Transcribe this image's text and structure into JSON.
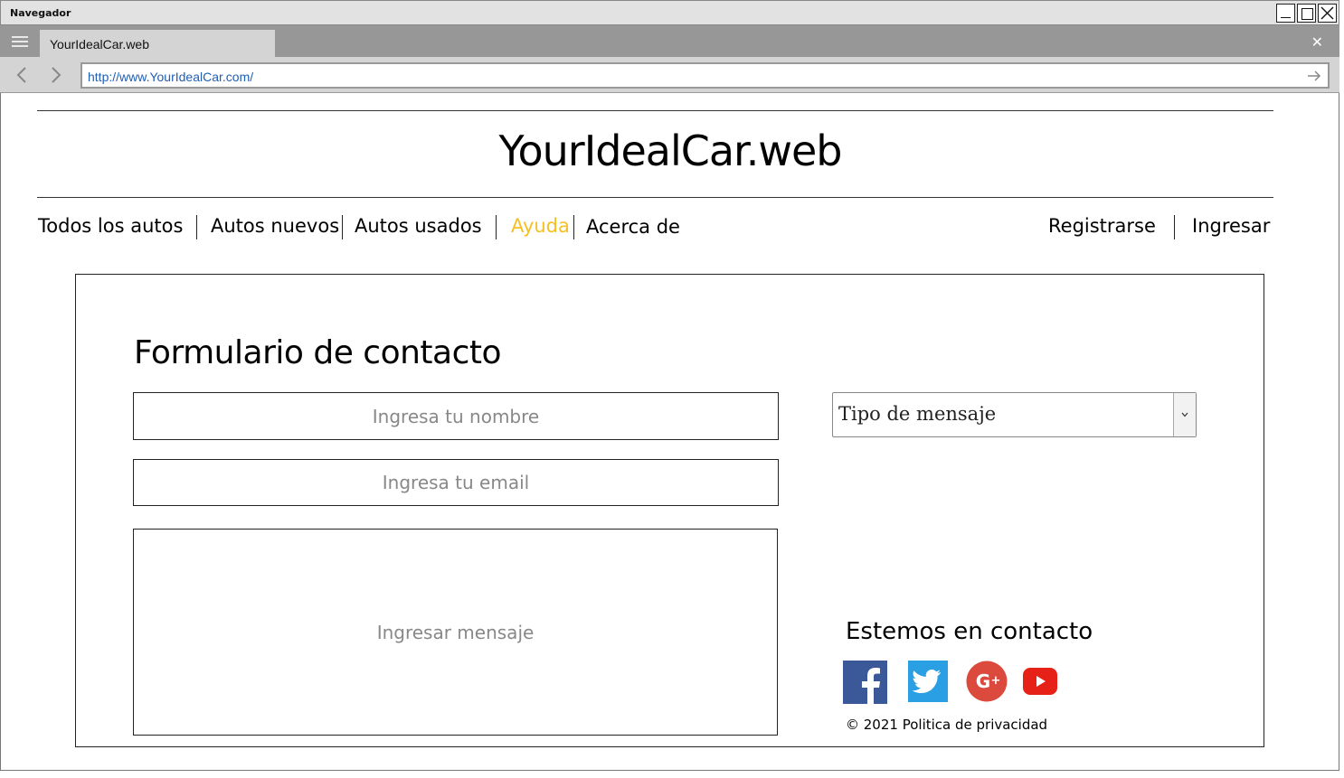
{
  "window": {
    "title": "Navegador"
  },
  "browser": {
    "tab_label": "YourIdealCar.web",
    "url": "http://www.YourIdealCar.com/"
  },
  "site": {
    "title": "YourIdealCar.web"
  },
  "nav": {
    "items": [
      {
        "label": "Todos los autos",
        "active": false
      },
      {
        "label": "Autos nuevos",
        "active": false
      },
      {
        "label": "Autos usados",
        "active": false
      },
      {
        "label": "Ayuda",
        "active": true
      },
      {
        "label": "Acerca de",
        "active": false
      }
    ],
    "register": "Registrarse",
    "login": "Ingresar",
    "active_color": "#f5c021"
  },
  "form": {
    "title": "Formulario de contacto",
    "name_placeholder": "Ingresa tu nombre",
    "email_placeholder": "Ingresa tu email",
    "message_placeholder": "Ingresar mensaje",
    "type_select": "Tipo de mensaje"
  },
  "footer": {
    "contact_title": "Estemos en contacto",
    "social_icons": [
      "facebook-icon",
      "twitter-icon",
      "google-plus-icon",
      "youtube-icon"
    ],
    "copyright": "© 2021 Politica de privacidad"
  }
}
